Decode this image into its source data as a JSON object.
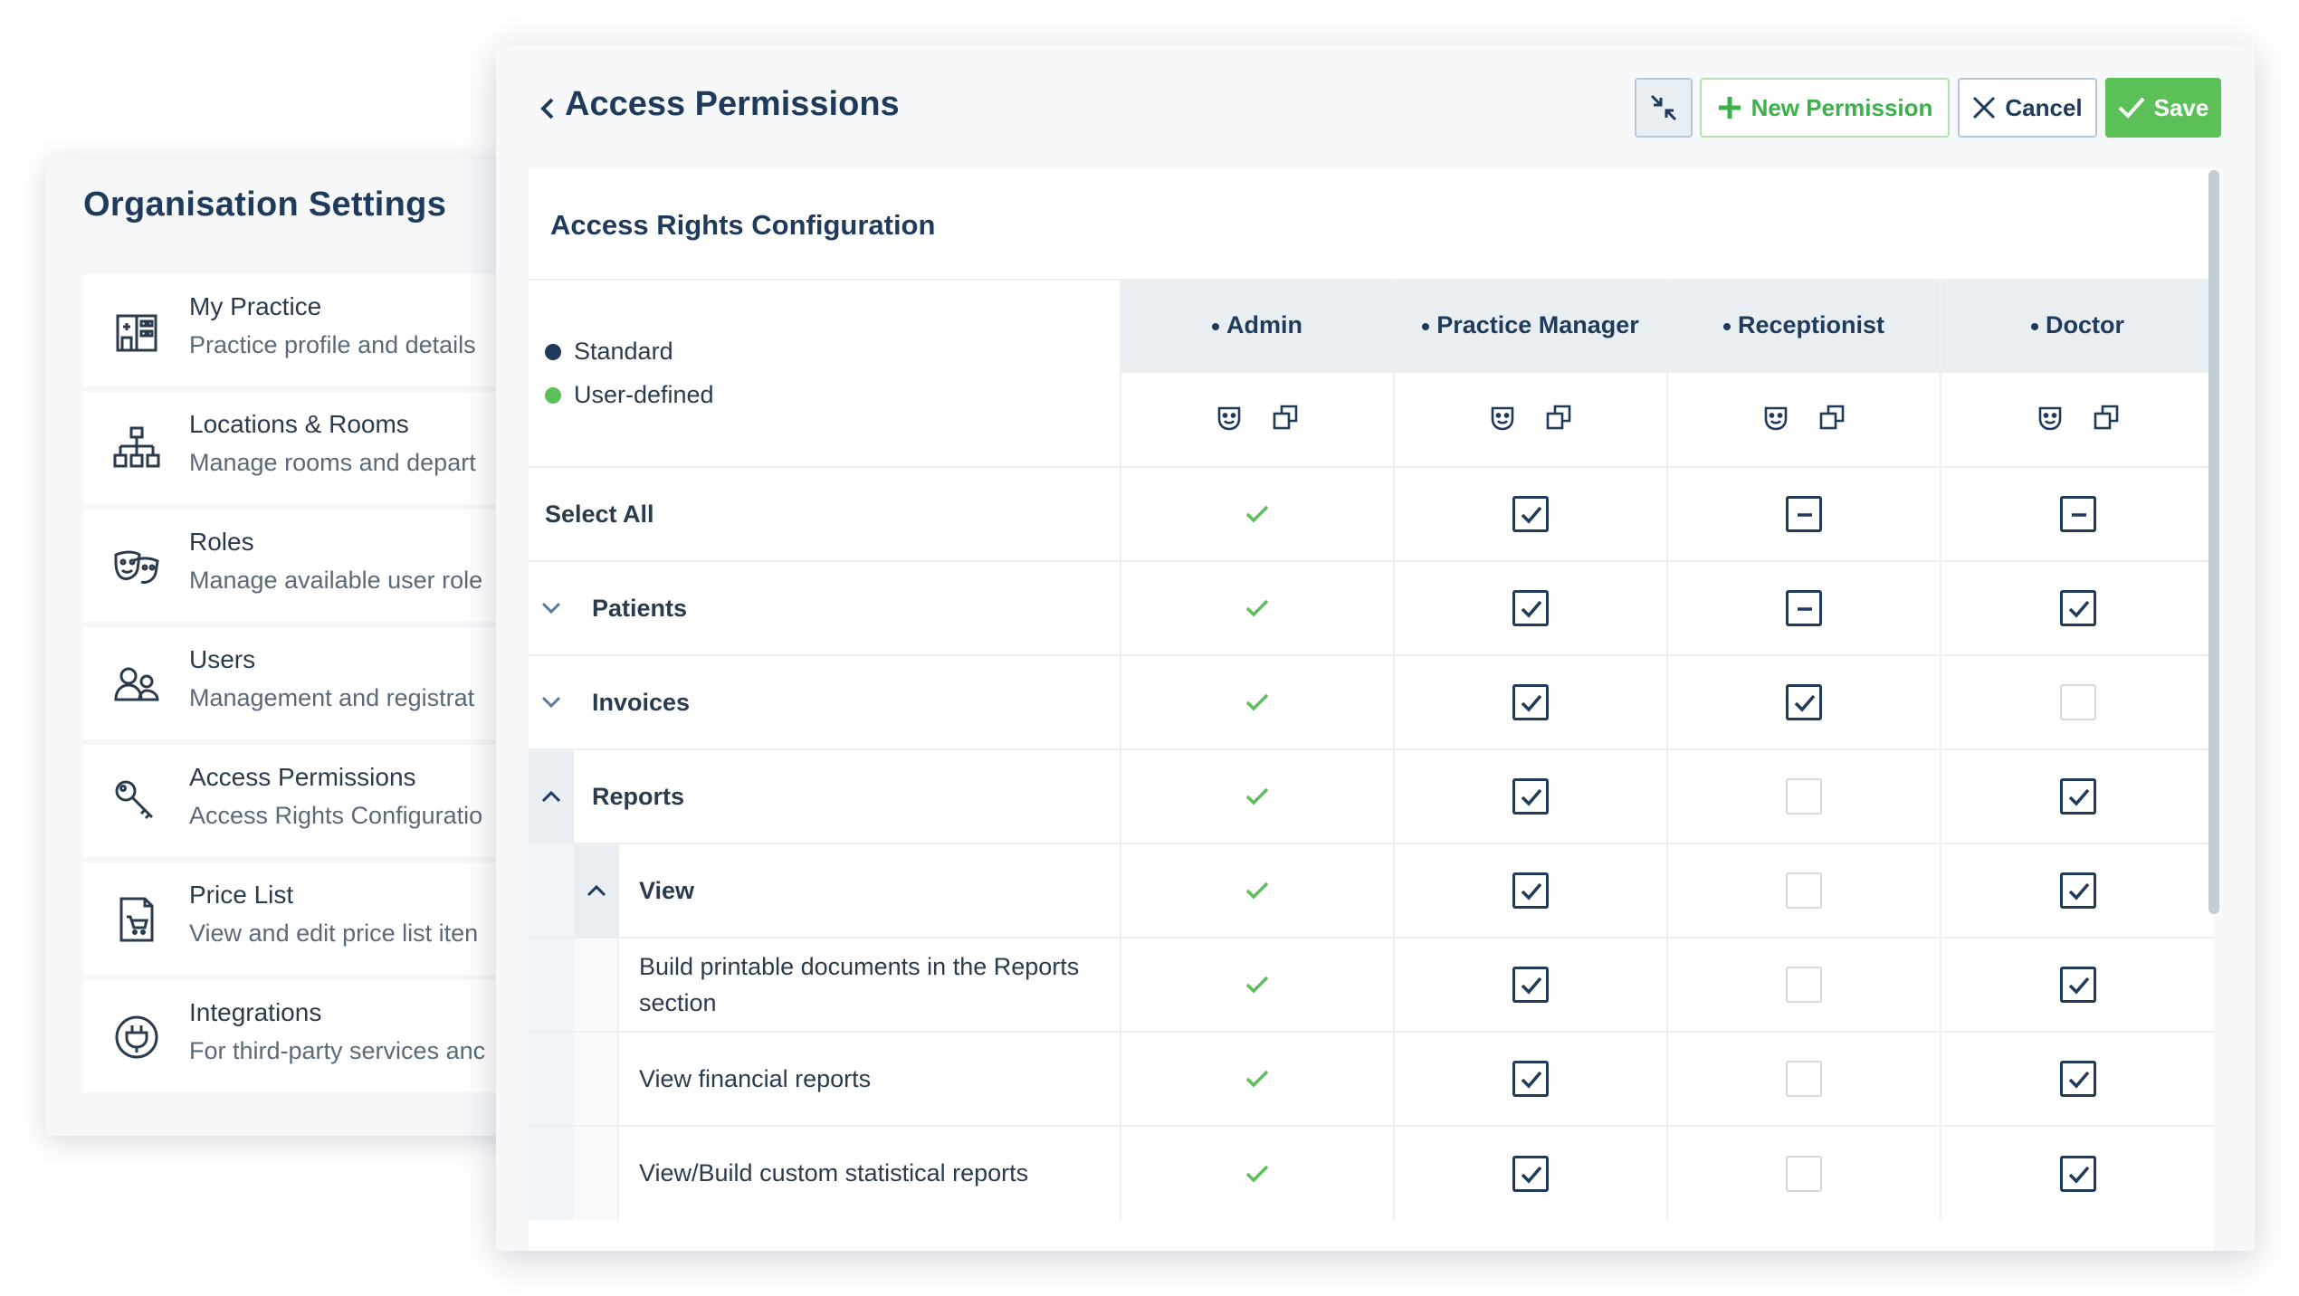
{
  "org": {
    "title": "Organisation Settings",
    "items": [
      {
        "title": "My Practice",
        "desc": "Practice profile and details",
        "icon": "building-icon"
      },
      {
        "title": "Locations & Rooms",
        "desc": "Manage rooms and depart",
        "icon": "hierarchy-icon"
      },
      {
        "title": "Roles",
        "desc": "Manage available user role",
        "icon": "masks-icon"
      },
      {
        "title": "Users",
        "desc": "Management and registrat",
        "icon": "users-icon"
      },
      {
        "title": "Access Permissions",
        "desc": "Access Rights Configuratio",
        "icon": "keys-icon"
      },
      {
        "title": "Price List",
        "desc": "View and edit price list iten",
        "icon": "price-list-icon"
      },
      {
        "title": "Integrations",
        "desc": "For third-party services anc",
        "icon": "plug-icon"
      }
    ]
  },
  "ap": {
    "title": "Access Permissions",
    "new_label": "New Permission",
    "cancel_label": "Cancel",
    "save_label": "Save",
    "card_title": "Access Rights Configuration",
    "legend": {
      "standard": "Standard",
      "user_defined": "User-defined"
    },
    "colors": {
      "standard": "#1f3a5a",
      "user_defined": "#5cc059"
    },
    "roles": [
      "Admin",
      "Practice Manager",
      "Receptionist",
      "Doctor"
    ],
    "rows": [
      {
        "label": "Select All",
        "level": 0,
        "expander": "none",
        "values": [
          "tick",
          "checked",
          "partial",
          "partial"
        ]
      },
      {
        "label": "Patients",
        "level": 1,
        "expander": "down",
        "values": [
          "tick",
          "checked",
          "partial",
          "checked"
        ]
      },
      {
        "label": "Invoices",
        "level": 1,
        "expander": "down",
        "values": [
          "tick",
          "checked",
          "checked",
          "empty"
        ]
      },
      {
        "label": "Reports",
        "level": 1,
        "expander": "up",
        "values": [
          "tick",
          "checked",
          "empty",
          "checked"
        ]
      },
      {
        "label": "View",
        "level": 2,
        "expander": "up",
        "values": [
          "tick",
          "checked",
          "empty",
          "checked"
        ]
      },
      {
        "label": "Build printable documents in the Reports section",
        "level": 3,
        "expander": "none",
        "values": [
          "tick",
          "checked",
          "empty",
          "checked"
        ]
      },
      {
        "label": "View financial reports",
        "level": 3,
        "expander": "none",
        "values": [
          "tick",
          "checked",
          "empty",
          "checked"
        ]
      },
      {
        "label": "View/Build custom statistical reports",
        "level": 3,
        "expander": "none",
        "values": [
          "tick",
          "checked",
          "empty",
          "checked"
        ]
      }
    ]
  }
}
